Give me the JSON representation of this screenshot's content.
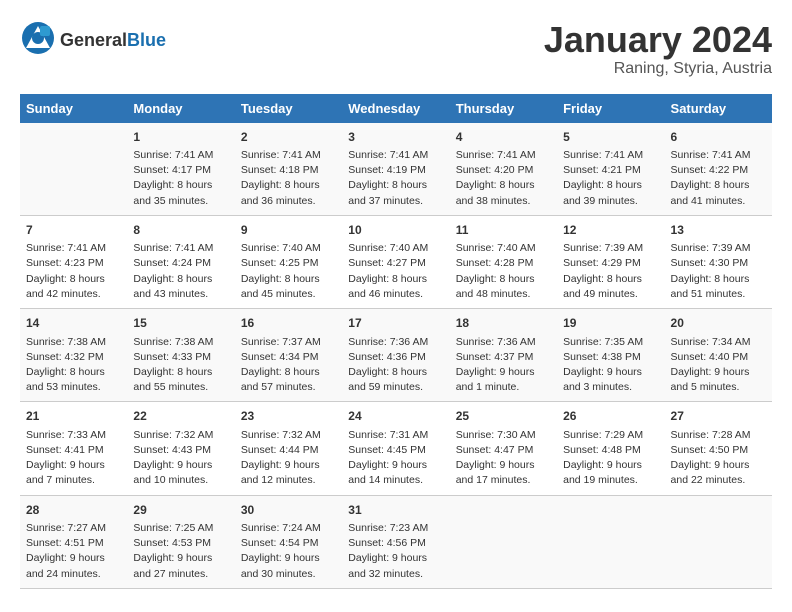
{
  "logo": {
    "general": "General",
    "blue": "Blue"
  },
  "title": "January 2024",
  "subtitle": "Raning, Styria, Austria",
  "days_header": [
    "Sunday",
    "Monday",
    "Tuesday",
    "Wednesday",
    "Thursday",
    "Friday",
    "Saturday"
  ],
  "weeks": [
    [
      {
        "day": "",
        "sunrise": "",
        "sunset": "",
        "daylight": ""
      },
      {
        "day": "1",
        "sunrise": "Sunrise: 7:41 AM",
        "sunset": "Sunset: 4:17 PM",
        "daylight": "Daylight: 8 hours and 35 minutes."
      },
      {
        "day": "2",
        "sunrise": "Sunrise: 7:41 AM",
        "sunset": "Sunset: 4:18 PM",
        "daylight": "Daylight: 8 hours and 36 minutes."
      },
      {
        "day": "3",
        "sunrise": "Sunrise: 7:41 AM",
        "sunset": "Sunset: 4:19 PM",
        "daylight": "Daylight: 8 hours and 37 minutes."
      },
      {
        "day": "4",
        "sunrise": "Sunrise: 7:41 AM",
        "sunset": "Sunset: 4:20 PM",
        "daylight": "Daylight: 8 hours and 38 minutes."
      },
      {
        "day": "5",
        "sunrise": "Sunrise: 7:41 AM",
        "sunset": "Sunset: 4:21 PM",
        "daylight": "Daylight: 8 hours and 39 minutes."
      },
      {
        "day": "6",
        "sunrise": "Sunrise: 7:41 AM",
        "sunset": "Sunset: 4:22 PM",
        "daylight": "Daylight: 8 hours and 41 minutes."
      }
    ],
    [
      {
        "day": "7",
        "sunrise": "Sunrise: 7:41 AM",
        "sunset": "Sunset: 4:23 PM",
        "daylight": "Daylight: 8 hours and 42 minutes."
      },
      {
        "day": "8",
        "sunrise": "Sunrise: 7:41 AM",
        "sunset": "Sunset: 4:24 PM",
        "daylight": "Daylight: 8 hours and 43 minutes."
      },
      {
        "day": "9",
        "sunrise": "Sunrise: 7:40 AM",
        "sunset": "Sunset: 4:25 PM",
        "daylight": "Daylight: 8 hours and 45 minutes."
      },
      {
        "day": "10",
        "sunrise": "Sunrise: 7:40 AM",
        "sunset": "Sunset: 4:27 PM",
        "daylight": "Daylight: 8 hours and 46 minutes."
      },
      {
        "day": "11",
        "sunrise": "Sunrise: 7:40 AM",
        "sunset": "Sunset: 4:28 PM",
        "daylight": "Daylight: 8 hours and 48 minutes."
      },
      {
        "day": "12",
        "sunrise": "Sunrise: 7:39 AM",
        "sunset": "Sunset: 4:29 PM",
        "daylight": "Daylight: 8 hours and 49 minutes."
      },
      {
        "day": "13",
        "sunrise": "Sunrise: 7:39 AM",
        "sunset": "Sunset: 4:30 PM",
        "daylight": "Daylight: 8 hours and 51 minutes."
      }
    ],
    [
      {
        "day": "14",
        "sunrise": "Sunrise: 7:38 AM",
        "sunset": "Sunset: 4:32 PM",
        "daylight": "Daylight: 8 hours and 53 minutes."
      },
      {
        "day": "15",
        "sunrise": "Sunrise: 7:38 AM",
        "sunset": "Sunset: 4:33 PM",
        "daylight": "Daylight: 8 hours and 55 minutes."
      },
      {
        "day": "16",
        "sunrise": "Sunrise: 7:37 AM",
        "sunset": "Sunset: 4:34 PM",
        "daylight": "Daylight: 8 hours and 57 minutes."
      },
      {
        "day": "17",
        "sunrise": "Sunrise: 7:36 AM",
        "sunset": "Sunset: 4:36 PM",
        "daylight": "Daylight: 8 hours and 59 minutes."
      },
      {
        "day": "18",
        "sunrise": "Sunrise: 7:36 AM",
        "sunset": "Sunset: 4:37 PM",
        "daylight": "Daylight: 9 hours and 1 minute."
      },
      {
        "day": "19",
        "sunrise": "Sunrise: 7:35 AM",
        "sunset": "Sunset: 4:38 PM",
        "daylight": "Daylight: 9 hours and 3 minutes."
      },
      {
        "day": "20",
        "sunrise": "Sunrise: 7:34 AM",
        "sunset": "Sunset: 4:40 PM",
        "daylight": "Daylight: 9 hours and 5 minutes."
      }
    ],
    [
      {
        "day": "21",
        "sunrise": "Sunrise: 7:33 AM",
        "sunset": "Sunset: 4:41 PM",
        "daylight": "Daylight: 9 hours and 7 minutes."
      },
      {
        "day": "22",
        "sunrise": "Sunrise: 7:32 AM",
        "sunset": "Sunset: 4:43 PM",
        "daylight": "Daylight: 9 hours and 10 minutes."
      },
      {
        "day": "23",
        "sunrise": "Sunrise: 7:32 AM",
        "sunset": "Sunset: 4:44 PM",
        "daylight": "Daylight: 9 hours and 12 minutes."
      },
      {
        "day": "24",
        "sunrise": "Sunrise: 7:31 AM",
        "sunset": "Sunset: 4:45 PM",
        "daylight": "Daylight: 9 hours and 14 minutes."
      },
      {
        "day": "25",
        "sunrise": "Sunrise: 7:30 AM",
        "sunset": "Sunset: 4:47 PM",
        "daylight": "Daylight: 9 hours and 17 minutes."
      },
      {
        "day": "26",
        "sunrise": "Sunrise: 7:29 AM",
        "sunset": "Sunset: 4:48 PM",
        "daylight": "Daylight: 9 hours and 19 minutes."
      },
      {
        "day": "27",
        "sunrise": "Sunrise: 7:28 AM",
        "sunset": "Sunset: 4:50 PM",
        "daylight": "Daylight: 9 hours and 22 minutes."
      }
    ],
    [
      {
        "day": "28",
        "sunrise": "Sunrise: 7:27 AM",
        "sunset": "Sunset: 4:51 PM",
        "daylight": "Daylight: 9 hours and 24 minutes."
      },
      {
        "day": "29",
        "sunrise": "Sunrise: 7:25 AM",
        "sunset": "Sunset: 4:53 PM",
        "daylight": "Daylight: 9 hours and 27 minutes."
      },
      {
        "day": "30",
        "sunrise": "Sunrise: 7:24 AM",
        "sunset": "Sunset: 4:54 PM",
        "daylight": "Daylight: 9 hours and 30 minutes."
      },
      {
        "day": "31",
        "sunrise": "Sunrise: 7:23 AM",
        "sunset": "Sunset: 4:56 PM",
        "daylight": "Daylight: 9 hours and 32 minutes."
      },
      {
        "day": "",
        "sunrise": "",
        "sunset": "",
        "daylight": ""
      },
      {
        "day": "",
        "sunrise": "",
        "sunset": "",
        "daylight": ""
      },
      {
        "day": "",
        "sunrise": "",
        "sunset": "",
        "daylight": ""
      }
    ]
  ]
}
